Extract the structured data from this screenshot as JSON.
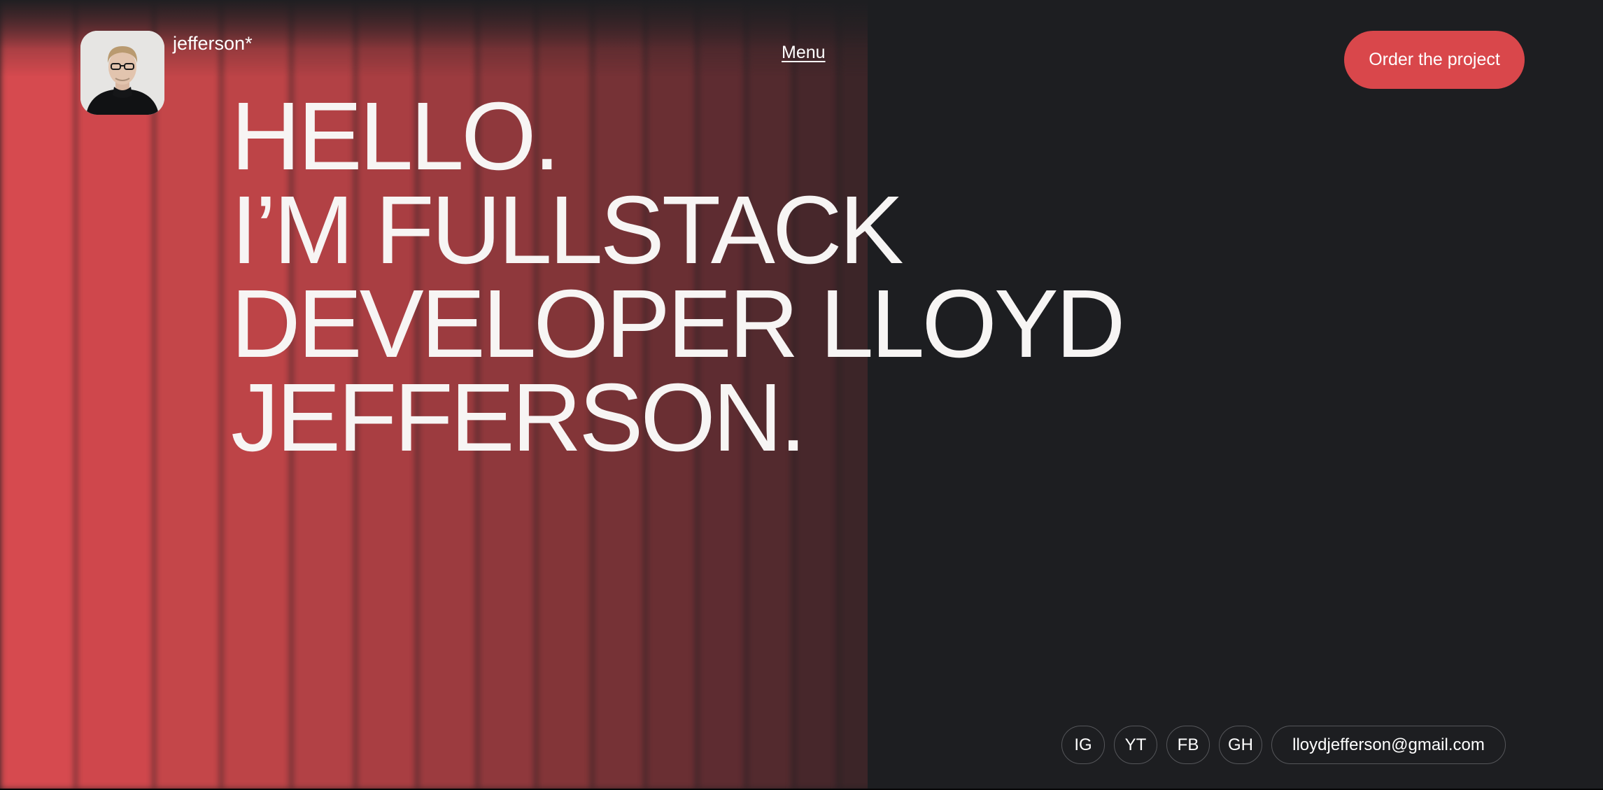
{
  "header": {
    "brand": "jefferson*",
    "menu_label": "Menu",
    "cta_label": "Order the project"
  },
  "hero": {
    "lines": [
      "HELLO.",
      "I’M FULLSTACK",
      "DEVELOPER LLOYD",
      "JEFFERSON."
    ]
  },
  "footer": {
    "social": [
      "IG",
      "YT",
      "FB",
      "GH"
    ],
    "email": "lloydjefferson@gmail.com"
  },
  "colors": {
    "background": "#1d1e21",
    "accent": "#d9474b",
    "text": "#ffffff"
  },
  "icons": {
    "avatar": "portrait-photo"
  }
}
